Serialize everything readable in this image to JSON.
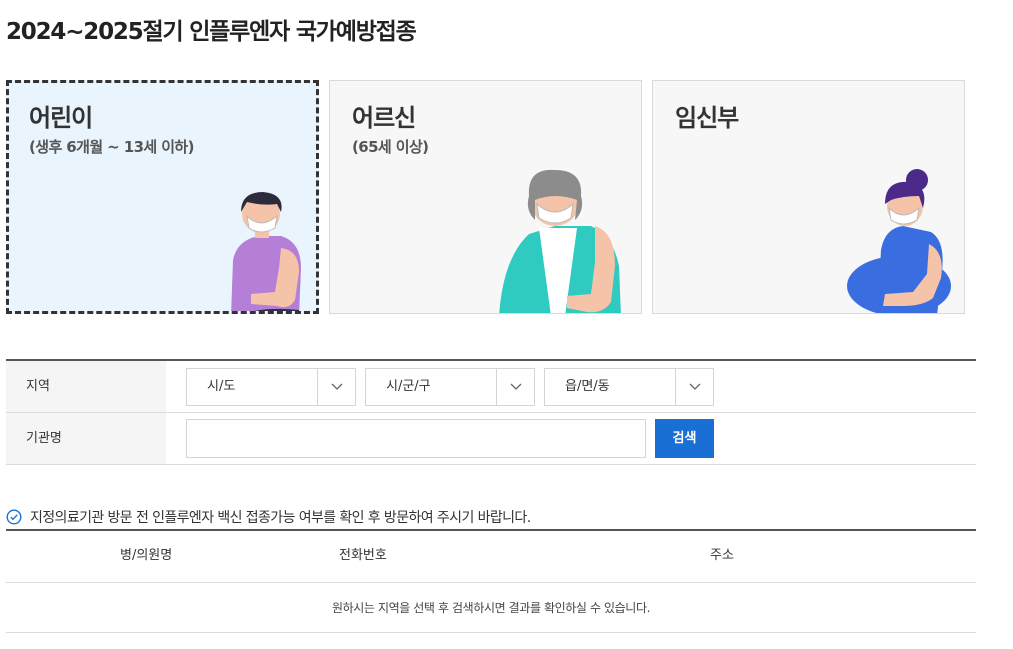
{
  "page": {
    "title": "2024~2025절기 인플루엔자 국가예방접종"
  },
  "cards": [
    {
      "title": "어린이",
      "subtitle": "(생후 6개월 ~ 13세 이하)",
      "selected": true
    },
    {
      "title": "어르신",
      "subtitle": "(65세 이상)",
      "selected": false
    },
    {
      "title": "임신부",
      "subtitle": "",
      "selected": false
    }
  ],
  "search_form": {
    "region_label": "지역",
    "selects": [
      {
        "value": "시/도",
        "icon": "chevron-down-icon"
      },
      {
        "value": "시/군/구",
        "icon": "chevron-down-icon"
      },
      {
        "value": "읍/면/동",
        "icon": "chevron-down-icon"
      }
    ],
    "institution_label": "기관명",
    "institution_value": "",
    "search_button": "검색"
  },
  "notice": {
    "icon": "check-circle-icon",
    "text": "지정의료기관 방문 전 인플루엔자 백신 접종가능 여부를 확인 후 방문하여 주시기 바랍니다."
  },
  "results": {
    "columns": [
      "병/의원명",
      "전화번호",
      "주소"
    ],
    "empty_message": "원하시는 지역을 선택 후 검색하시면 결과를 확인하실 수 있습니다."
  },
  "colors": {
    "accent": "#1a6fd4",
    "selected_card_bg": "#eaf4fd",
    "card_bg": "#f7f7f7"
  }
}
